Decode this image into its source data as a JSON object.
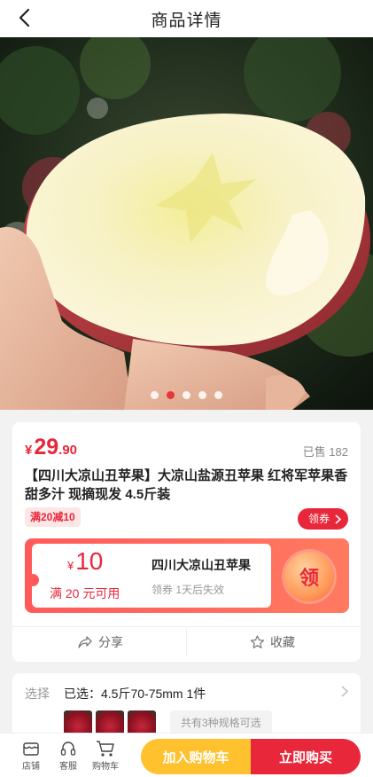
{
  "header": {
    "title": "商品详情"
  },
  "gallery": {
    "dot_count": 5,
    "active_index": 1
  },
  "product": {
    "price_currency": "¥",
    "price_int": "29",
    "price_dec": ".90",
    "sold": "已售 182",
    "title": "【四川大凉山丑苹果】大凉山盐源丑苹果 红将军苹果香甜多汁 现摘现发  4.5斤装",
    "promo_tag": "满20减10",
    "get_coupon_label": "领券"
  },
  "coupon": {
    "currency": "¥",
    "amount": "10",
    "condition": "满 20 元可用",
    "name": "四川大凉山丑苹果",
    "validity": "领券 1天后失效",
    "claim_label": "领"
  },
  "actions": {
    "share_label": "分享",
    "favorite_label": "收藏"
  },
  "spec": {
    "label": "选择",
    "selected": "已选：4.5斤70-75mm  1件",
    "more_options": "共有3种规格可选"
  },
  "bottom_bar": {
    "store_label": "店铺",
    "service_label": "客服",
    "cart_label": "购物车",
    "add_to_cart_label": "加入购物车",
    "buy_now_label": "立即购买"
  },
  "colors": {
    "accent_red": "#e8273a",
    "cart_yellow": "#ffc22e"
  }
}
